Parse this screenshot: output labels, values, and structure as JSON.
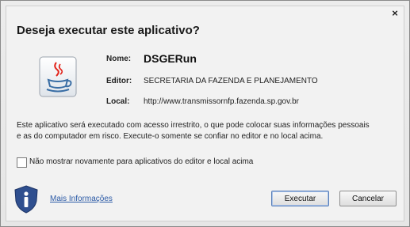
{
  "dialog": {
    "close_glyph": "×",
    "title": "Deseja executar este aplicativo?"
  },
  "app": {
    "name_label": "Nome:",
    "name": "DSGERun",
    "publisher_label": "Editor:",
    "publisher": "SECRETARIA DA FAZENDA E PLANEJAMENTO",
    "location_label": "Local:",
    "location": "http://www.transmissornfp.fazenda.sp.gov.br",
    "icon": "java-icon"
  },
  "warning": {
    "line1": "Este aplicativo será executado com acesso irrestrito, o que pode colocar suas informações pessoais",
    "line2": "e as do computador em risco. Execute-o somente se confiar no editor e no local acima."
  },
  "checkbox": {
    "label": "Não mostrar novamente para aplicativos do editor e local acima",
    "checked": false
  },
  "footer": {
    "info_icon": "shield-info-icon",
    "more_info": "Mais Informações",
    "run_button": "Executar",
    "cancel_button": "Cancelar"
  },
  "colors": {
    "link": "#2b5aa6",
    "shield": "#2f4f8f"
  }
}
